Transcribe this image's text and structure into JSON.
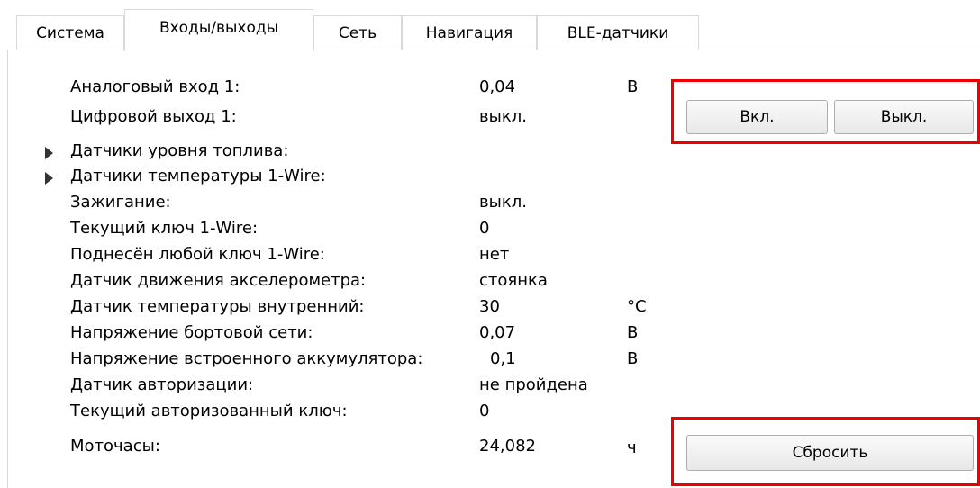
{
  "tabs": [
    {
      "label": "Система"
    },
    {
      "label": "Входы/выходы"
    },
    {
      "label": "Сеть"
    },
    {
      "label": "Навигация"
    },
    {
      "label": "BLE-датчики"
    }
  ],
  "rows": [
    {
      "label": "Аналоговый вход 1:",
      "value": "0,04",
      "unit": "В"
    },
    {
      "label": "Цифровой выход 1:",
      "value": "выкл.",
      "unit": ""
    },
    {
      "label": "Датчики уровня топлива:",
      "value": "",
      "unit": ""
    },
    {
      "label": "Датчики температуры 1-Wire:",
      "value": "",
      "unit": ""
    },
    {
      "label": "Зажигание:",
      "value": "выкл.",
      "unit": ""
    },
    {
      "label": "Текущий ключ 1-Wire:",
      "value": "0",
      "unit": ""
    },
    {
      "label": "Поднесён любой ключ 1-Wire:",
      "value": "нет",
      "unit": ""
    },
    {
      "label": "Датчик движения акселерометра:",
      "value": "стоянка",
      "unit": ""
    },
    {
      "label": "Датчик температуры внутренний:",
      "value": "30",
      "unit": "°C"
    },
    {
      "label": "Напряжение бортовой сети:",
      "value": "0,07",
      "unit": "В"
    },
    {
      "label": "Напряжение встроенного аккумулятора:",
      "value": "0,1",
      "unit": "В"
    },
    {
      "label": "Датчик авторизации:",
      "value": "не пройдена",
      "unit": ""
    },
    {
      "label": "Текущий авторизованный ключ:",
      "value": "0",
      "unit": ""
    },
    {
      "label": "Моточасы:",
      "value": "24,082",
      "unit": "ч"
    }
  ],
  "buttons": {
    "on": "Вкл.",
    "off": "Выкл.",
    "reset": "Сбросить"
  },
  "highlight_color": "#ee0000"
}
